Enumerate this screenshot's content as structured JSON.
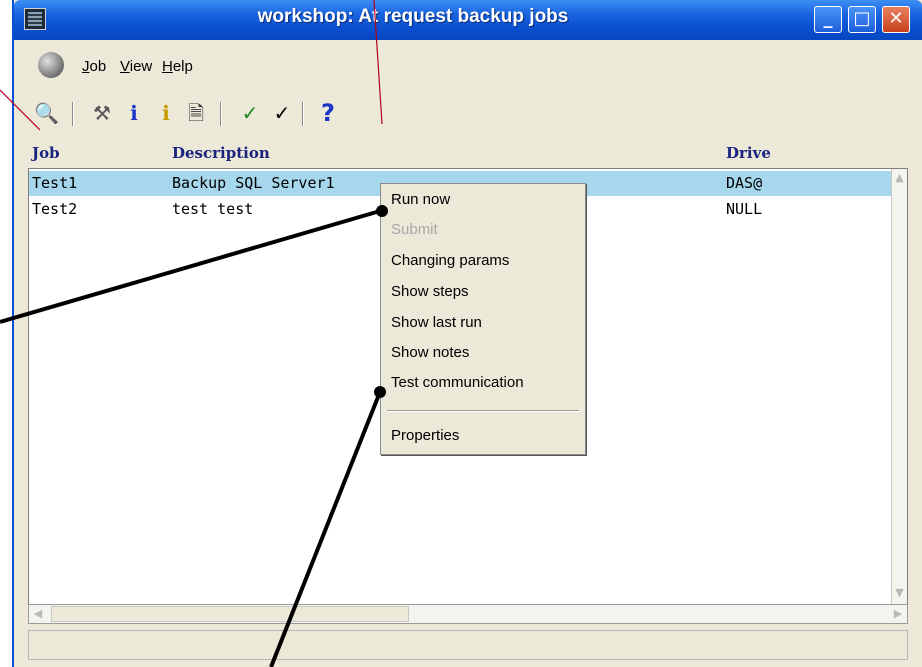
{
  "window": {
    "title": "workshop: At request backup jobs"
  },
  "titlebar_buttons": {
    "minimize": "_",
    "maximize": "□",
    "close": "✕"
  },
  "menubar": {
    "items": [
      {
        "accel": "J",
        "rest": "ob"
      },
      {
        "accel": "V",
        "rest": "iew"
      },
      {
        "accel": "H",
        "rest": "elp"
      }
    ]
  },
  "toolbar": {
    "icons": [
      {
        "name": "search-icon",
        "glyph": "🔍",
        "color": "#1c3aa9"
      },
      {
        "name": "tools-icon",
        "glyph": "⚒",
        "color": "#555555"
      },
      {
        "name": "info-blue-icon",
        "glyph": "ℹ",
        "color": "#1a35c8"
      },
      {
        "name": "info-yellow-icon",
        "glyph": "ℹ",
        "color": "#c89a00"
      },
      {
        "name": "document-icon",
        "glyph": "🗎",
        "color": "#333333"
      },
      {
        "name": "checkmark-green-icon",
        "glyph": "✓",
        "color": "#1d8a1d"
      },
      {
        "name": "checkmark-black-icon",
        "glyph": "✓",
        "color": "#000000"
      },
      {
        "name": "help-icon",
        "glyph": "?",
        "color": "#1a35c8"
      }
    ]
  },
  "columns": {
    "job": "Job",
    "description": "Description",
    "drive": "Drive"
  },
  "rows": [
    {
      "job": "Test1",
      "description": "Backup SQL Server1",
      "drive": "DAS@"
    },
    {
      "job": "Test2",
      "description": "test test",
      "drive": "NULL"
    }
  ],
  "context_menu": {
    "items": [
      {
        "label": "Run now",
        "disabled": false
      },
      {
        "label": "Submit",
        "disabled": true
      },
      {
        "label": "Changing params",
        "disabled": false
      },
      {
        "label": "Show steps",
        "disabled": false
      },
      {
        "label": "Show last run",
        "disabled": false
      },
      {
        "label": "Show notes",
        "disabled": false
      },
      {
        "label": "Test communication",
        "disabled": false
      }
    ],
    "footer": {
      "label": "Properties"
    }
  },
  "colors": {
    "titlebar": "#0a50d0",
    "selected_row": "#a6d7ec",
    "header_text": "#1a237e",
    "callout_thin": "#b3001b"
  }
}
